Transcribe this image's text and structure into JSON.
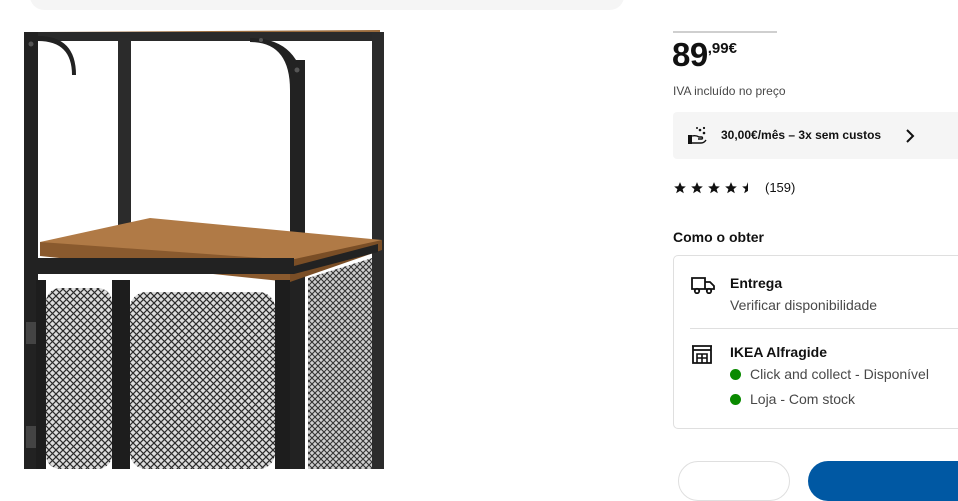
{
  "price": {
    "integer": "89",
    "decimals": ",99",
    "currency": "€"
  },
  "vat_note": "IVA incluído no preço",
  "installment": {
    "text": "30,00€/mês – 3x sem custos",
    "icon": "hand-coins-icon"
  },
  "rating": {
    "stars": 4.5,
    "count": "(159)"
  },
  "fulfilment": {
    "title": "Como o obter",
    "delivery": {
      "title": "Entrega",
      "subtitle": "Verificar disponibilidade",
      "icon": "truck-icon"
    },
    "store": {
      "name": "IKEA Alfragide",
      "icon": "store-icon",
      "statuses": [
        {
          "text": "Click and collect - Disponível",
          "color": "#0a8a00"
        },
        {
          "text": "Loja - Com stock",
          "color": "#0a8a00"
        }
      ]
    }
  },
  "colors": {
    "accent": "#0058a3",
    "available": "#0a8a00",
    "panel_bg": "#f5f5f5"
  }
}
